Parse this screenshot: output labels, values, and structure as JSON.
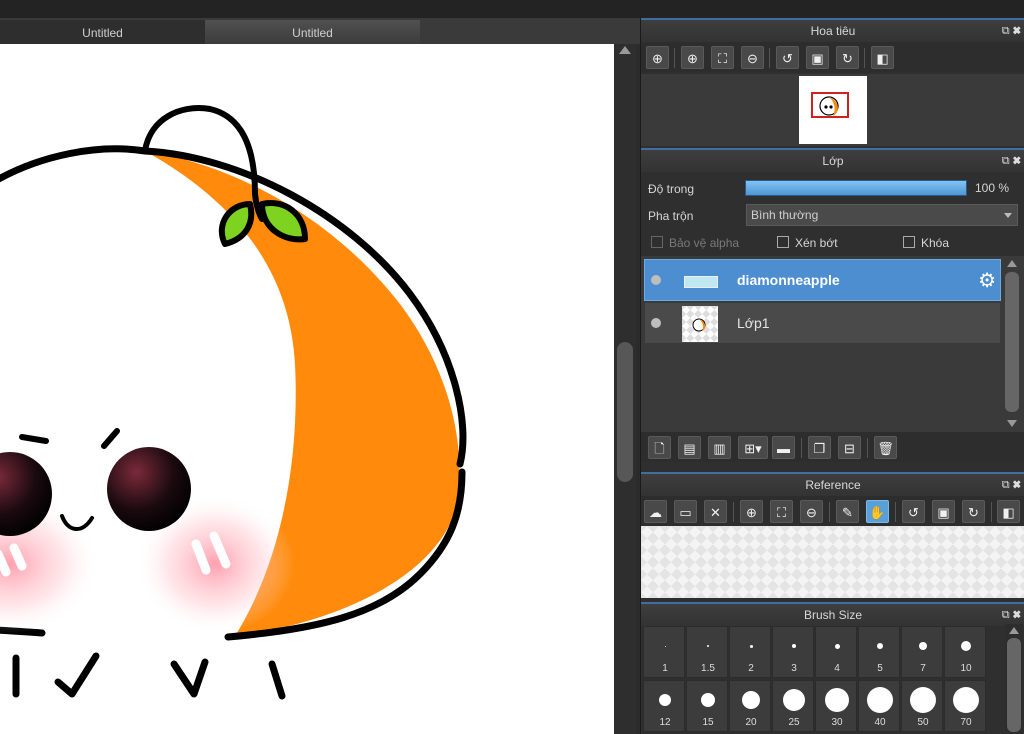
{
  "tabs": [
    {
      "label": "Untitled"
    },
    {
      "label": "Untitled"
    }
  ],
  "navigator": {
    "title": "Hoa tiêu",
    "tools": [
      "zoom-in-icon",
      "zoom-in-icon",
      "fit-icon",
      "zoom-out-icon",
      "rotate-left-icon",
      "actual-size-icon",
      "rotate-right-icon",
      "flip-icon"
    ]
  },
  "layers": {
    "title": "Lớp",
    "opacity_label": "Độ trong",
    "opacity_value": "100 %",
    "opacity_fraction": 1.0,
    "blend_label": "Pha trộn",
    "blend_value": "Bình thường",
    "protect_alpha_label": "Bảo vệ alpha",
    "clipping_label": "Xén bớt",
    "lock_label": "Khóa",
    "items": [
      {
        "name": "diamonneapple",
        "selected": true
      },
      {
        "name": "Lớp1",
        "selected": false
      }
    ]
  },
  "reference": {
    "title": "Reference"
  },
  "brush_size": {
    "title": "Brush Size",
    "sizes": [
      "1",
      "1.5",
      "2",
      "3",
      "4",
      "5",
      "7",
      "10",
      "12",
      "15",
      "20",
      "25",
      "30",
      "40",
      "50",
      "70"
    ]
  },
  "colors": {
    "accent": "#4d8ed0",
    "orange": "#ff8a0c",
    "leaf": "#7ed321",
    "cheek": "#ff8fa0"
  }
}
